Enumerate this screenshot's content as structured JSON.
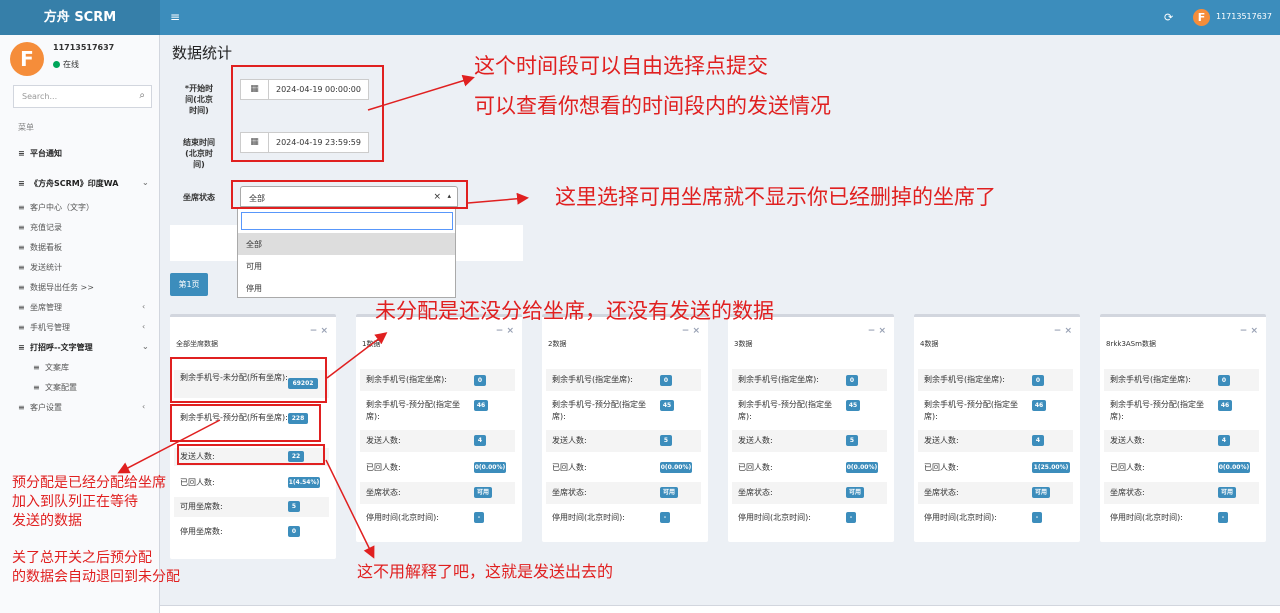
{
  "app": {
    "brand": "方舟 SCRM",
    "username": "11713517637",
    "avatar_letter": "F",
    "online_label": "在线",
    "menu_icon": "≡",
    "refresh_icon": "⟳",
    "accent": "#3c8dbc",
    "header_bg": "#3c8dbc",
    "brand_bg": "#367fa9"
  },
  "sidebar": {
    "search_placeholder": "Search...",
    "menu_header": "菜单",
    "items": [
      {
        "label": "平台通知",
        "icon": "≡"
      },
      {
        "label": "《方舟SCRM》印度WA",
        "icon": "≡",
        "caret": "⌄"
      },
      {
        "label": "客户中心（文字）",
        "icon": "≡"
      },
      {
        "label": "充值记录",
        "icon": "≡"
      },
      {
        "label": "数据看板",
        "icon": "≡"
      },
      {
        "label": "发送统计",
        "icon": "≡"
      },
      {
        "label": "数据导出任务 >>",
        "icon": "≡"
      },
      {
        "label": "坐席管理",
        "icon": "≡",
        "caret": "‹"
      },
      {
        "label": "手机号管理",
        "icon": "≡",
        "caret": "‹"
      },
      {
        "label": "打招呼--文字管理",
        "icon": "≡",
        "caret": "⌄"
      },
      {
        "label": "文案库",
        "icon": "≡"
      },
      {
        "label": "文案配置",
        "icon": "≡"
      },
      {
        "label": "客户设置",
        "icon": "≡",
        "caret": "‹"
      }
    ]
  },
  "page": {
    "title": "数据统计",
    "start_label": [
      "*开始时",
      "间(北京",
      "时间)"
    ],
    "start_value": "2024-04-19 00:00:00",
    "end_label": [
      "结束时间",
      "(北京时",
      "间)"
    ],
    "end_value": "2024-04-19 23:59:59",
    "seat_status_label": "坐席状态",
    "seat_status_value": "全部",
    "clear_icon": "×",
    "arrow_icon": "▴",
    "options": [
      "全部",
      "可用",
      "停用"
    ],
    "page_button": "第1页",
    "calendar_icon": "▦"
  },
  "summary": {
    "title": "全部坐席数据",
    "tools": "−  ×",
    "rows": [
      {
        "label": "剩余手机号-未分配(所有坐席):",
        "value": "69202"
      },
      {
        "label": "剩余手机号-预分配(所有坐席):",
        "value": "228"
      },
      {
        "label": "发送人数:",
        "value": "22"
      },
      {
        "label": "已回人数:",
        "value": "1(4.54%)"
      },
      {
        "label": "可用坐席数:",
        "value": "5"
      },
      {
        "label": "停用坐席数:",
        "value": "0"
      }
    ]
  },
  "seat_row_labels": [
    "剩余手机号(指定坐席):",
    "剩余手机号-预分配(指定坐席):",
    "发送人数:",
    "已回人数:",
    "坐席状态:",
    "停用时间(北京时间):"
  ],
  "seats": [
    {
      "title": "1数据",
      "values": [
        "0",
        "46",
        "4",
        "0(0.00%)",
        "可用",
        "-"
      ]
    },
    {
      "title": "2数据",
      "values": [
        "0",
        "45",
        "5",
        "0(0.00%)",
        "可用",
        "-"
      ]
    },
    {
      "title": "3数据",
      "values": [
        "0",
        "45",
        "5",
        "0(0.00%)",
        "可用",
        "-"
      ]
    },
    {
      "title": "4数据",
      "values": [
        "0",
        "46",
        "4",
        "1(25.00%)",
        "可用",
        "-"
      ]
    },
    {
      "title": "8rkk3ASm数据",
      "values": [
        "0",
        "46",
        "4",
        "0(0.00%)",
        "可用",
        "-"
      ]
    }
  ],
  "annotations": {
    "time_1": "这个时间段可以自由选择点提交",
    "time_2": "可以查看你想看的时间段内的发送情况",
    "seat_note": "这里选择可用坐席就不显示你已经删掉的坐席了",
    "unassigned_note": "未分配是还没分给坐席，还没有发送的数据",
    "pre_1": "预分配是已经分配给坐席",
    "pre_2": "加入到队列正在等待",
    "pre_3": "发送的数据",
    "switch_1": "关了总开关之后预分配",
    "switch_2": "的数据会自动退回到未分配",
    "sent_note": "这不用解释了吧，这就是发送出去的",
    "color": "#e02020"
  }
}
